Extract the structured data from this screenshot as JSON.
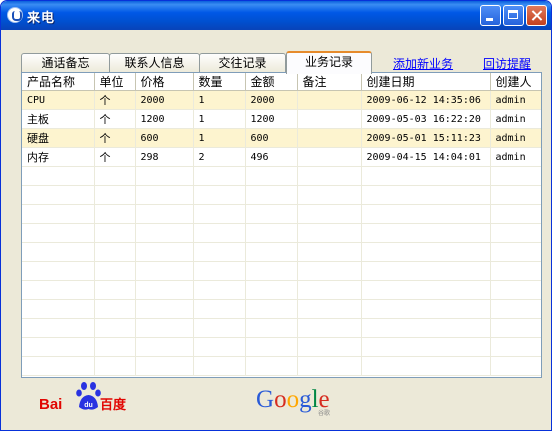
{
  "window": {
    "title": "来电"
  },
  "tabs": [
    {
      "label": "通话备忘",
      "active": false
    },
    {
      "label": "联系人信息",
      "active": false
    },
    {
      "label": "交往记录",
      "active": false
    },
    {
      "label": "业务记录",
      "active": true
    }
  ],
  "links": {
    "add_business": "添加新业务",
    "followup_reminder": "回访提醒"
  },
  "table": {
    "columns": [
      "产品名称",
      "单位",
      "价格",
      "数量",
      "金额",
      "备注",
      "创建日期",
      "创建人"
    ],
    "rows": [
      [
        "CPU",
        "个",
        "2000",
        "1",
        "2000",
        "",
        "2009-06-12 14:35:06",
        "admin"
      ],
      [
        "主板",
        "个",
        "1200",
        "1",
        "1200",
        "",
        "2009-05-03 16:22:20",
        "admin"
      ],
      [
        "硬盘",
        "个",
        "600",
        "1",
        "600",
        "",
        "2009-05-01 15:11:23",
        "admin"
      ],
      [
        "内存",
        "个",
        "298",
        "2",
        "496",
        "",
        "2009-04-15 14:04:01",
        "admin"
      ]
    ],
    "empty_rows": 11
  },
  "logos": {
    "baidu": "Baidu百度",
    "google": "Google",
    "google_sub": "谷歌"
  },
  "colors": {
    "row_highlight": "#fdf4cf",
    "link": "#0000ff",
    "tab_active_accent": "#e68b2c",
    "titlebar": "#0054e3"
  }
}
